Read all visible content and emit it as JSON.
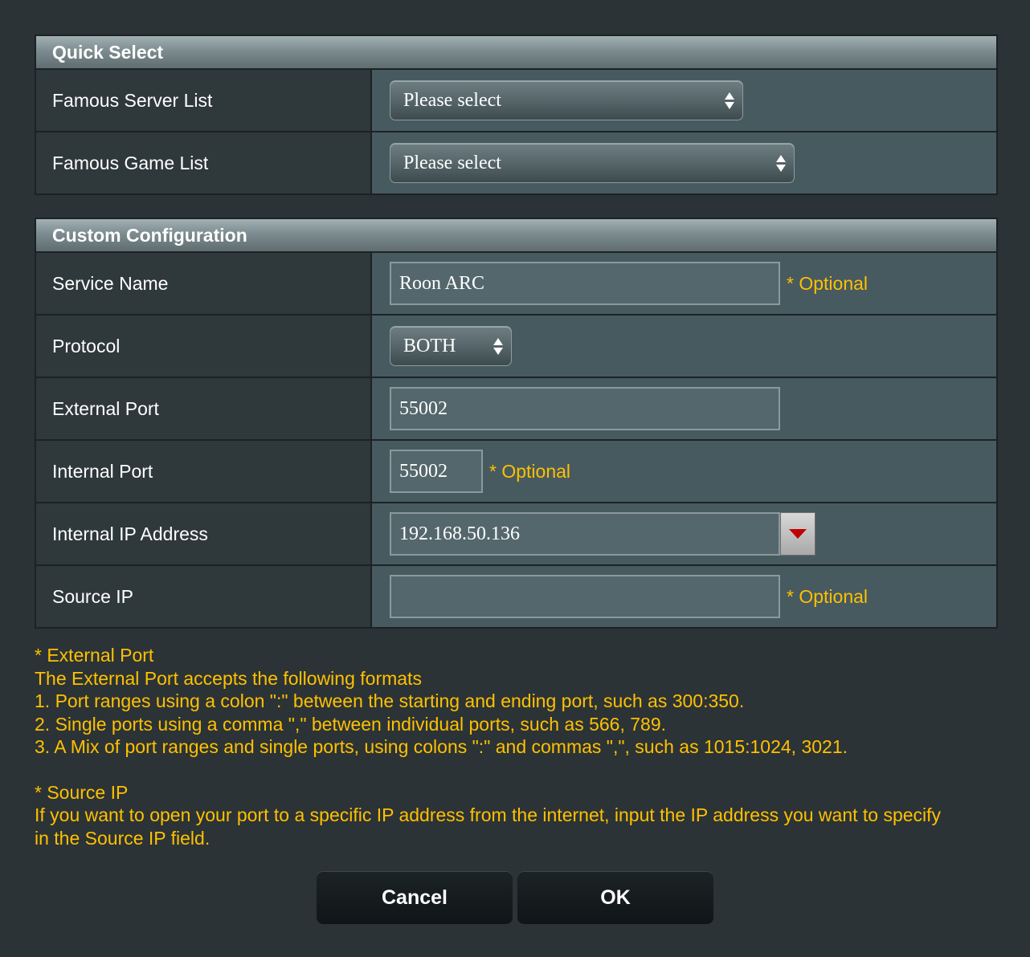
{
  "quick_select": {
    "title": "Quick Select",
    "famous_server_list": {
      "label": "Famous Server List",
      "value": "Please select"
    },
    "famous_game_list": {
      "label": "Famous Game List",
      "value": "Please select"
    }
  },
  "custom_configuration": {
    "title": "Custom Configuration",
    "service_name": {
      "label": "Service Name",
      "value": "Roon ARC",
      "note": "* Optional"
    },
    "protocol": {
      "label": "Protocol",
      "value": "BOTH"
    },
    "external_port": {
      "label": "External Port",
      "value": "55002"
    },
    "internal_port": {
      "label": "Internal Port",
      "value": "55002",
      "note": "* Optional"
    },
    "internal_ip": {
      "label": "Internal IP Address",
      "value": "192.168.50.136"
    },
    "source_ip": {
      "label": "Source IP",
      "value": "",
      "note": "* Optional"
    }
  },
  "notes": {
    "external_port_title": "* External Port",
    "external_port_lines": [
      "The External Port accepts the following formats",
      "1. Port ranges using a colon \":\" between the starting and ending port, such as 300:350.",
      "2. Single ports using a comma \",\" between individual ports, such as 566, 789.",
      "3. A Mix of port ranges and single ports, using colons \":\" and commas \",\", such as 1015:1024, 3021."
    ],
    "source_ip_title": "* Source IP",
    "source_ip_lines": [
      "If you want to open your port to a specific IP address from the internet, input the IP address you want to specify",
      "in the Source IP field."
    ]
  },
  "buttons": {
    "cancel": "Cancel",
    "ok": "OK"
  },
  "colors": {
    "accent_note": "#ffc000",
    "dropdown_arrow": "#c00000"
  }
}
